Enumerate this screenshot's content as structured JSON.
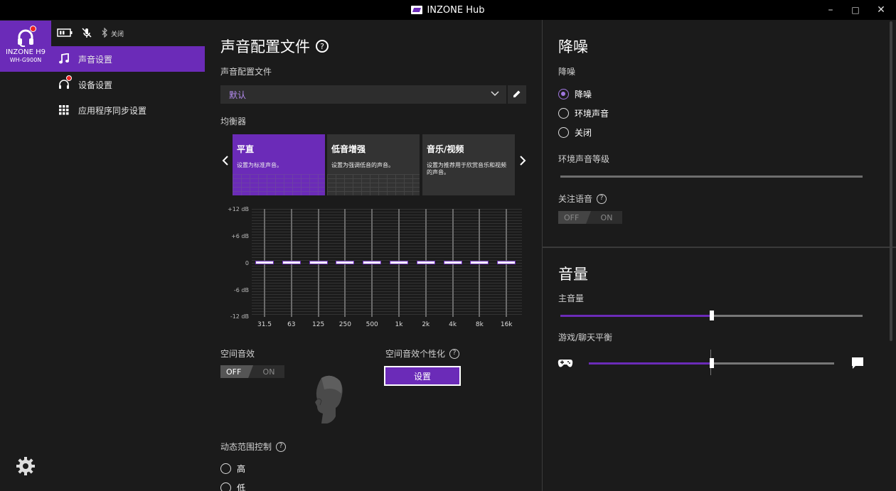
{
  "window": {
    "title": "INZONE Hub",
    "minimize": "–",
    "maximize": "□",
    "close": "✕"
  },
  "device": {
    "name": "INZONE H9",
    "model": "WH-G900N",
    "status_label": "关闭"
  },
  "sidebar": {
    "items": [
      {
        "label": "声音设置",
        "icon": "music-note-icon",
        "active": true
      },
      {
        "label": "设备设置",
        "icon": "headphones-icon",
        "active": false
      },
      {
        "label": "应用程序同步设置",
        "icon": "grid-icon",
        "active": false
      }
    ]
  },
  "sound": {
    "title": "声音配置文件",
    "profile_label": "声音配置文件",
    "profile_value": "默认",
    "eq_label": "均衡器",
    "presets": [
      {
        "title": "平直",
        "desc": "设置为标准声音。",
        "active": true
      },
      {
        "title": "低音增强",
        "desc": "设置为强调低音的声音。",
        "active": false
      },
      {
        "title": "音乐/视频",
        "desc": "设置为推荐用于欣赏音乐和视频的声音。",
        "active": false
      }
    ],
    "eq_db_labels": [
      "+12 dB",
      "+6 dB",
      "0",
      "-6 dB",
      "-12 dB"
    ],
    "eq_bands": [
      "31.5",
      "63",
      "125",
      "250",
      "500",
      "1k",
      "2k",
      "4k",
      "8k",
      "16k"
    ],
    "eq_gains_db": [
      0,
      0,
      0,
      0,
      0,
      0,
      0,
      0,
      0,
      0
    ],
    "spatial_label": "空间音效",
    "spatial_toggle": {
      "off": "OFF",
      "on": "ON",
      "state": "OFF"
    },
    "spatial_personal_label": "空间音效个性化",
    "setup_button": "设置",
    "drc_label": "动态范围控制",
    "drc_options": [
      {
        "label": "高",
        "checked": false
      },
      {
        "label": "低",
        "checked": false
      }
    ]
  },
  "nc": {
    "title": "降噪",
    "section_label": "降噪",
    "options": [
      {
        "label": "降噪",
        "checked": true
      },
      {
        "label": "环境声音",
        "checked": false
      },
      {
        "label": "关闭",
        "checked": false
      }
    ],
    "ambient_level_label": "环境声音等级",
    "ambient_level": 0,
    "focus_voice_label": "关注语音",
    "focus_toggle": {
      "off": "OFF",
      "on": "ON",
      "state": "OFF"
    }
  },
  "volume": {
    "title": "音量",
    "master_label": "主音量",
    "master_value": 0.5,
    "balance_label": "游戏/聊天平衡",
    "balance_value": 0.5
  },
  "colors": {
    "accent": "#6b2bb8",
    "accent_light": "#a077e0",
    "bg": "#1b1b1b"
  }
}
